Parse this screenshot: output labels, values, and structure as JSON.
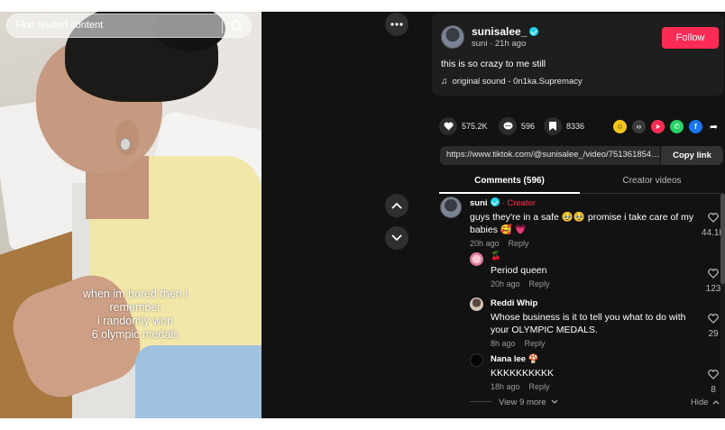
{
  "search": {
    "placeholder": "Find related content"
  },
  "video": {
    "caption_lines": [
      "when im bored then i",
      "remember",
      "i randomly won",
      "6 olympic medals"
    ]
  },
  "author": {
    "username": "sunisalee_",
    "display_name": "suni",
    "age": "21h ago",
    "follow_label": "Follow",
    "description": "this is so crazy to me still",
    "sound": "original sound - 0n1ka.Supremacy"
  },
  "stats": {
    "likes": "575.2K",
    "comments": "596",
    "saves": "8336"
  },
  "share": {
    "link": "https://www.tiktok.com/@sunisalee_/video/7513618543...",
    "copy_label": "Copy link"
  },
  "tabs": [
    {
      "label": "Comments (596)"
    },
    {
      "label": "Creator videos"
    }
  ],
  "comments": [
    {
      "name": "suni",
      "tag": "· Creator",
      "text": "guys they're in a safe 🥹🥹 promise i take care of my babies 🥰 💗",
      "time": "20h ago",
      "reply": "Reply",
      "likes": "44.1K"
    }
  ],
  "replies": [
    {
      "name": "🍒",
      "text": "Period queen",
      "time": "20h ago",
      "reply": "Reply",
      "likes": "123"
    },
    {
      "name": "Reddi Whip",
      "text": "Whose business is it to tell you what to do with your OLYMPIC MEDALS.",
      "time": "8h ago",
      "reply": "Reply",
      "likes": "29"
    },
    {
      "name": "Nana lee 🍄",
      "text": "KKKKKKKKKK",
      "time": "18h ago",
      "reply": "Reply",
      "likes": "8"
    }
  ],
  "thread": {
    "view_more": "View 9 more",
    "hide": "Hide"
  },
  "colors": {
    "accent": "#fe2c55",
    "verified": "#20d5ec",
    "panel_bg": "#121212"
  }
}
